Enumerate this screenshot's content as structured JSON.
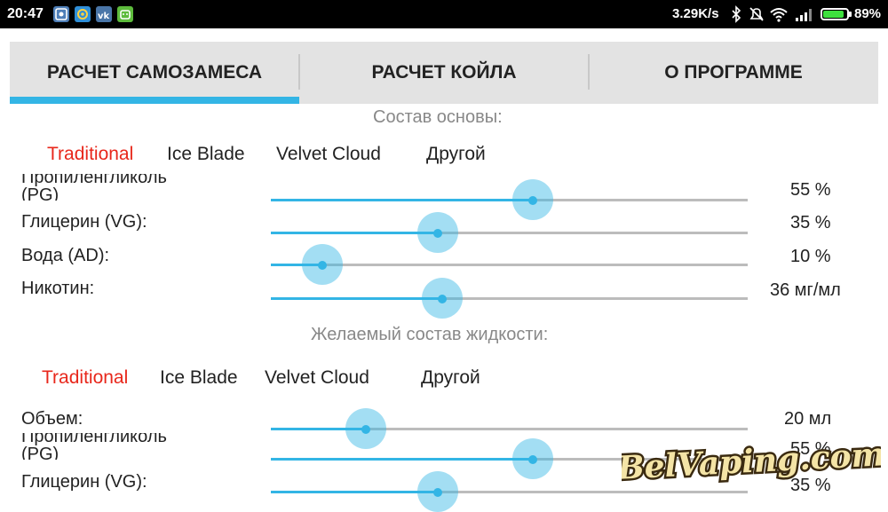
{
  "status_bar": {
    "time": "20:47",
    "net_speed": "3.29K/s",
    "battery_percent": "89%",
    "battery_level": 0.89,
    "icons": [
      "gallery-icon",
      "email-icon",
      "vk-icon",
      "android-icon",
      "bluetooth-icon",
      "mute-icon",
      "wifi-icon",
      "signal-icon",
      "battery-icon"
    ],
    "colors": {
      "background": "#000000",
      "battery": "#3ee03e"
    }
  },
  "tabs": [
    {
      "label": "РАСЧЕТ САМОЗАМЕСА",
      "active": true
    },
    {
      "label": "РАСЧЕТ КОЙЛА",
      "active": false
    },
    {
      "label": "О ПРОГРАММЕ",
      "active": false
    }
  ],
  "colors": {
    "accent": "#33b5e5",
    "active_preset": "#e8271b",
    "tab_bar_bg": "#e3e3e3"
  },
  "base_section": {
    "title": "Состав основы:",
    "presets": [
      "Traditional",
      "Ice Blade",
      "Velvet Cloud",
      "Другой"
    ],
    "active_preset": "Traditional",
    "rows": [
      {
        "label_line1": "Пропиленгликоль",
        "label_line2": "(PG)",
        "value": "55 %",
        "level": 0.55
      },
      {
        "label_line1": "Глицерин (VG):",
        "value": "35 %",
        "level": 0.35
      },
      {
        "label_line1": "Вода (AD):",
        "value": "10 %",
        "level": 0.108
      },
      {
        "label_line1": "Никотин:",
        "value": "36 мг/мл",
        "level": 0.36
      }
    ]
  },
  "target_section": {
    "title": "Желаемый состав жидкости:",
    "presets": [
      "Traditional",
      "Ice Blade",
      "Velvet Cloud",
      "Другой"
    ],
    "active_preset": "Traditional",
    "rows": [
      {
        "label_line1": "Объем:",
        "value": "20 мл",
        "level": 0.2
      },
      {
        "label_line1": "Пропиленгликоль",
        "label_line2": "(PG)",
        "value": "55 %",
        "level": 0.55
      },
      {
        "label_line1": "Глицерин (VG):",
        "value": "35 %",
        "level": 0.35
      }
    ]
  },
  "watermark": {
    "text": "BelVaping.com"
  }
}
